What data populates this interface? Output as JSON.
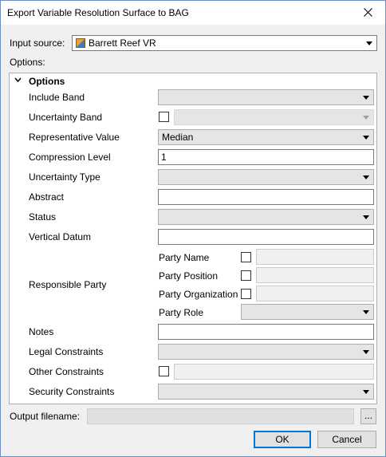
{
  "window": {
    "title": "Export Variable Resolution Surface to BAG"
  },
  "input_source": {
    "label": "Input source:",
    "value": "Barrett Reef VR"
  },
  "options_label": "Options:",
  "options_group": {
    "header": "Options"
  },
  "fields": {
    "include_band": {
      "label": "Include Band",
      "value": ""
    },
    "uncertainty_band": {
      "label": "Uncertainty Band",
      "checked": false,
      "value": ""
    },
    "representative_value": {
      "label": "Representative Value",
      "value": "Median"
    },
    "compression_level": {
      "label": "Compression Level",
      "value": "1"
    },
    "uncertainty_type": {
      "label": "Uncertainty Type",
      "value": ""
    },
    "abstract": {
      "label": "Abstract",
      "value": ""
    },
    "status": {
      "label": "Status",
      "value": ""
    },
    "vertical_datum": {
      "label": "Vertical Datum",
      "value": ""
    },
    "responsible_party": {
      "label": "Responsible Party",
      "party_name": {
        "label": "Party Name",
        "checked": false,
        "value": ""
      },
      "party_position": {
        "label": "Party Position",
        "checked": false,
        "value": ""
      },
      "party_organization": {
        "label": "Party Organization",
        "checked": false,
        "value": ""
      },
      "party_role": {
        "label": "Party Role",
        "value": ""
      }
    },
    "notes": {
      "label": "Notes",
      "value": ""
    },
    "legal_constraints": {
      "label": "Legal Constraints",
      "value": ""
    },
    "other_constraints": {
      "label": "Other Constraints",
      "checked": false,
      "value": ""
    },
    "security_constraints": {
      "label": "Security Constraints",
      "value": ""
    }
  },
  "output": {
    "label": "Output filename:",
    "value": "",
    "browse_label": "..."
  },
  "buttons": {
    "ok": "OK",
    "cancel": "Cancel"
  },
  "icons": {
    "close": "close-icon",
    "expand": "chevron-down-icon",
    "source": "surface-layer-icon"
  },
  "colors": {
    "accent": "#0078d7",
    "border": "#adadad",
    "disabled_bg": "#e5e5e5"
  }
}
